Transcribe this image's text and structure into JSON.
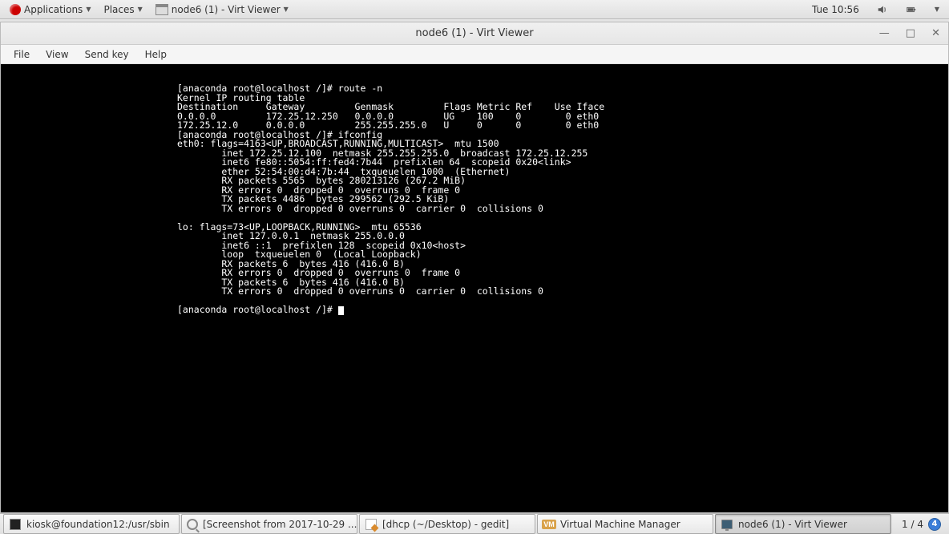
{
  "top_panel": {
    "applications": "Applications",
    "places": "Places",
    "running_title": "node6 (1) - Virt Viewer",
    "clock": "Tue 10:56"
  },
  "viewer": {
    "title": "node6 (1) - Virt Viewer",
    "menus": {
      "file": "File",
      "view": "View",
      "sendkey": "Send key",
      "help": "Help"
    }
  },
  "terminal": {
    "lines": [
      "[anaconda root@localhost /]# route -n",
      "Kernel IP routing table",
      "Destination     Gateway         Genmask         Flags Metric Ref    Use Iface",
      "0.0.0.0         172.25.12.250   0.0.0.0         UG    100    0        0 eth0",
      "172.25.12.0     0.0.0.0         255.255.255.0   U     0      0        0 eth0",
      "[anaconda root@localhost /]# ifconfig",
      "eth0: flags=4163<UP,BROADCAST,RUNNING,MULTICAST>  mtu 1500",
      "        inet 172.25.12.100  netmask 255.255.255.0  broadcast 172.25.12.255",
      "        inet6 fe80::5054:ff:fed4:7b44  prefixlen 64  scopeid 0x20<link>",
      "        ether 52:54:00:d4:7b:44  txqueuelen 1000  (Ethernet)",
      "        RX packets 5565  bytes 280213126 (267.2 MiB)",
      "        RX errors 0  dropped 0  overruns 0  frame 0",
      "        TX packets 4486  bytes 299562 (292.5 KiB)",
      "        TX errors 0  dropped 0 overruns 0  carrier 0  collisions 0",
      "",
      "lo: flags=73<UP,LOOPBACK,RUNNING>  mtu 65536",
      "        inet 127.0.0.1  netmask 255.0.0.0",
      "        inet6 ::1  prefixlen 128  scopeid 0x10<host>",
      "        loop  txqueuelen 0  (Local Loopback)",
      "        RX packets 6  bytes 416 (416.0 B)",
      "        RX errors 0  dropped 0  overruns 0  frame 0",
      "        TX packets 6  bytes 416 (416.0 B)",
      "        TX errors 0  dropped 0 overruns 0  carrier 0  collisions 0",
      "",
      "[anaconda root@localhost /]# "
    ]
  },
  "taskbar": {
    "items": [
      {
        "label": "kiosk@foundation12:/usr/sbin",
        "icon": "terminal"
      },
      {
        "label": "[Screenshot from 2017-10-29 ...",
        "icon": "magnifier"
      },
      {
        "label": "[dhcp (~/Desktop) - gedit]",
        "icon": "gedit"
      },
      {
        "label": "Virtual Machine Manager",
        "icon": "vmm"
      },
      {
        "label": "node6 (1) - Virt Viewer",
        "icon": "monitor",
        "active": true
      }
    ],
    "workspace_label": "1 / 4",
    "workspace_badge": "4"
  }
}
